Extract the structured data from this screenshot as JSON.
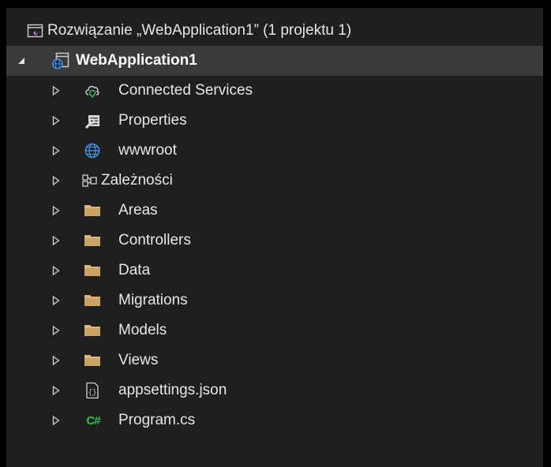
{
  "solution": {
    "label": "Rozwiązanie „WebApplication1” (1 projektu 1)",
    "icon": "solution-icon"
  },
  "project": {
    "label": "WebApplication1",
    "icon": "web-project-icon",
    "expanded": true
  },
  "items": [
    {
      "label": "Connected Services",
      "icon": "connected-services-icon"
    },
    {
      "label": "Properties",
      "icon": "properties-wrench-icon"
    },
    {
      "label": "wwwroot",
      "icon": "globe-icon"
    },
    {
      "label": "Zależności",
      "icon": "dependencies-icon"
    },
    {
      "label": "Areas",
      "icon": "folder-icon"
    },
    {
      "label": "Controllers",
      "icon": "folder-icon"
    },
    {
      "label": "Data",
      "icon": "folder-icon"
    },
    {
      "label": "Migrations",
      "icon": "folder-icon"
    },
    {
      "label": "Models",
      "icon": "folder-icon"
    },
    {
      "label": "Views",
      "icon": "folder-icon"
    },
    {
      "label": "appsettings.json",
      "icon": "json-file-icon"
    },
    {
      "label": "Program.cs",
      "icon": "csharp-file-icon",
      "glyph": "C#"
    }
  ],
  "colors": {
    "background": "#1f1f1f",
    "selection": "#3a3a3a",
    "text": "#e6e6e6",
    "folder": "#dcb67a",
    "globe": "#3d8fe6",
    "csharp": "#33c24d"
  }
}
